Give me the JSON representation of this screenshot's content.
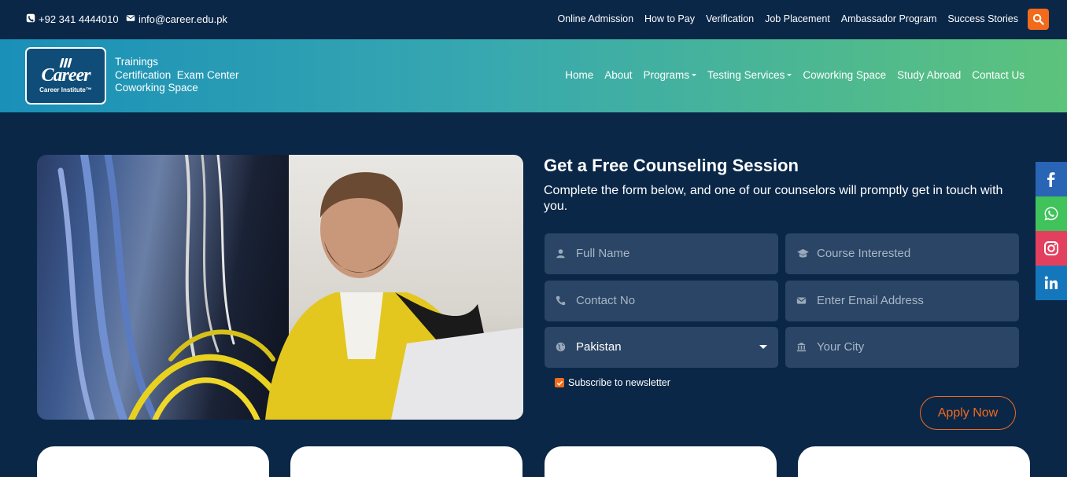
{
  "topbar": {
    "phone": "+92 341 4444010",
    "email": "info@career.edu.pk",
    "links": [
      "Online Admission",
      "How to Pay",
      "Verification",
      "Job Placement",
      "Ambassador Program",
      "Success Stories"
    ]
  },
  "header": {
    "logo": {
      "mark": "Career",
      "sub": "Career Institute™"
    },
    "tagline": [
      "Trainings",
      "Certification  Exam Center",
      "Coworking Space"
    ],
    "nav": [
      {
        "label": "Home",
        "dropdown": false
      },
      {
        "label": "About",
        "dropdown": false
      },
      {
        "label": "Programs",
        "dropdown": true
      },
      {
        "label": "Testing Services",
        "dropdown": true
      },
      {
        "label": "Coworking Space",
        "dropdown": false
      },
      {
        "label": "Study Abroad",
        "dropdown": false
      },
      {
        "label": "Contact Us",
        "dropdown": false
      }
    ]
  },
  "form": {
    "title": "Get a Free Counseling Session",
    "subtitle": "Complete the form below, and one of our counselors will promptly get in touch with you.",
    "full_name_placeholder": "Full Name",
    "course_placeholder": "Course Interested",
    "contact_placeholder": "Contact No",
    "email_placeholder": "Enter Email Address",
    "country_value": "Pakistan",
    "city_placeholder": "Your City",
    "subscribe_label": "Subscribe to newsletter",
    "subscribe_checked": true,
    "apply_label": "Apply Now"
  },
  "social": [
    {
      "name": "facebook",
      "color": "#2a64b4"
    },
    {
      "name": "whatsapp",
      "color": "#3fc35a"
    },
    {
      "name": "instagram",
      "color": "#e3405f"
    },
    {
      "name": "linkedin",
      "color": "#1477bb"
    }
  ],
  "colors": {
    "accent": "#f26a1b",
    "background": "#0a2748",
    "field": "#2a4565"
  }
}
